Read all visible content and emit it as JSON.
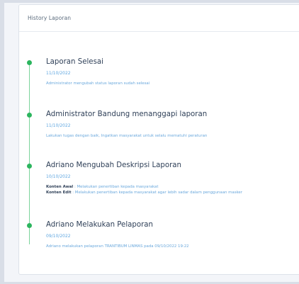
{
  "panel": {
    "title": "History Laporan"
  },
  "history": [
    {
      "title": "Laporan Selesai",
      "date": "11/10/2022",
      "description": "Administrator mengubah status laporan sudah selesai"
    },
    {
      "title": "Administrator Bandung menanggapi laporan",
      "date": "11/10/2022",
      "description": "Lakukan tugas dengan baik, Ingatkan masyarakat untuk selalu mematuhi peraturan"
    },
    {
      "title": "Adriano Mengubah Deskripsi Laporan",
      "date": "10/10/2022",
      "old_label": "Konten Awal",
      "old_text": ": Melakukan penertiban kepada masyarakat",
      "new_label": "Konten Edit",
      "new_text": ": Melakukan penertiban kepada masyarakat agar lebih sadar dalam penggunaan masker"
    },
    {
      "title": "Adriano Melakukan Pelaporan",
      "date": "09/10/2022",
      "description": "Adriano melakukan pelaporan TRANTIBUM LINMAS pada 09/10/2022 19:22"
    }
  ],
  "colors": {
    "accent_green": "#2cb55e",
    "link_blue": "#6aa8dc",
    "title_dark": "#2f4058"
  }
}
